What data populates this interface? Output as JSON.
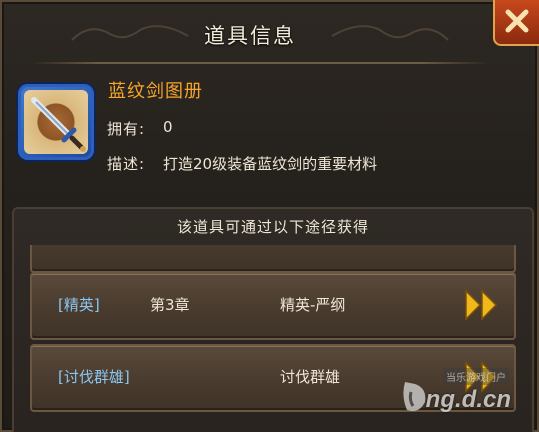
{
  "dialog": {
    "title": "道具信息"
  },
  "item": {
    "name": "蓝纹剑图册",
    "owned_label": "拥有:",
    "owned_value": "0",
    "desc_label": "描述:",
    "desc_value": "打造20级装备蓝纹剑的重要材料"
  },
  "sources": {
    "header": "该道具可通过以下途径获得",
    "rows": [
      {
        "tag": "[精英]",
        "chapter": "第3章",
        "stage": "精英-严纲"
      },
      {
        "tag": "[讨伐群雄]",
        "chapter": "",
        "stage": "讨伐群雄"
      }
    ]
  },
  "watermark": {
    "small": "当乐游戏门户",
    "big": "ng.d.cn"
  },
  "colors": {
    "item_name": "#f7a52a",
    "tag": "#8cc6ef",
    "text": "#f0e6d6",
    "close": "#c8481c",
    "arrow": "#f1b81c"
  }
}
